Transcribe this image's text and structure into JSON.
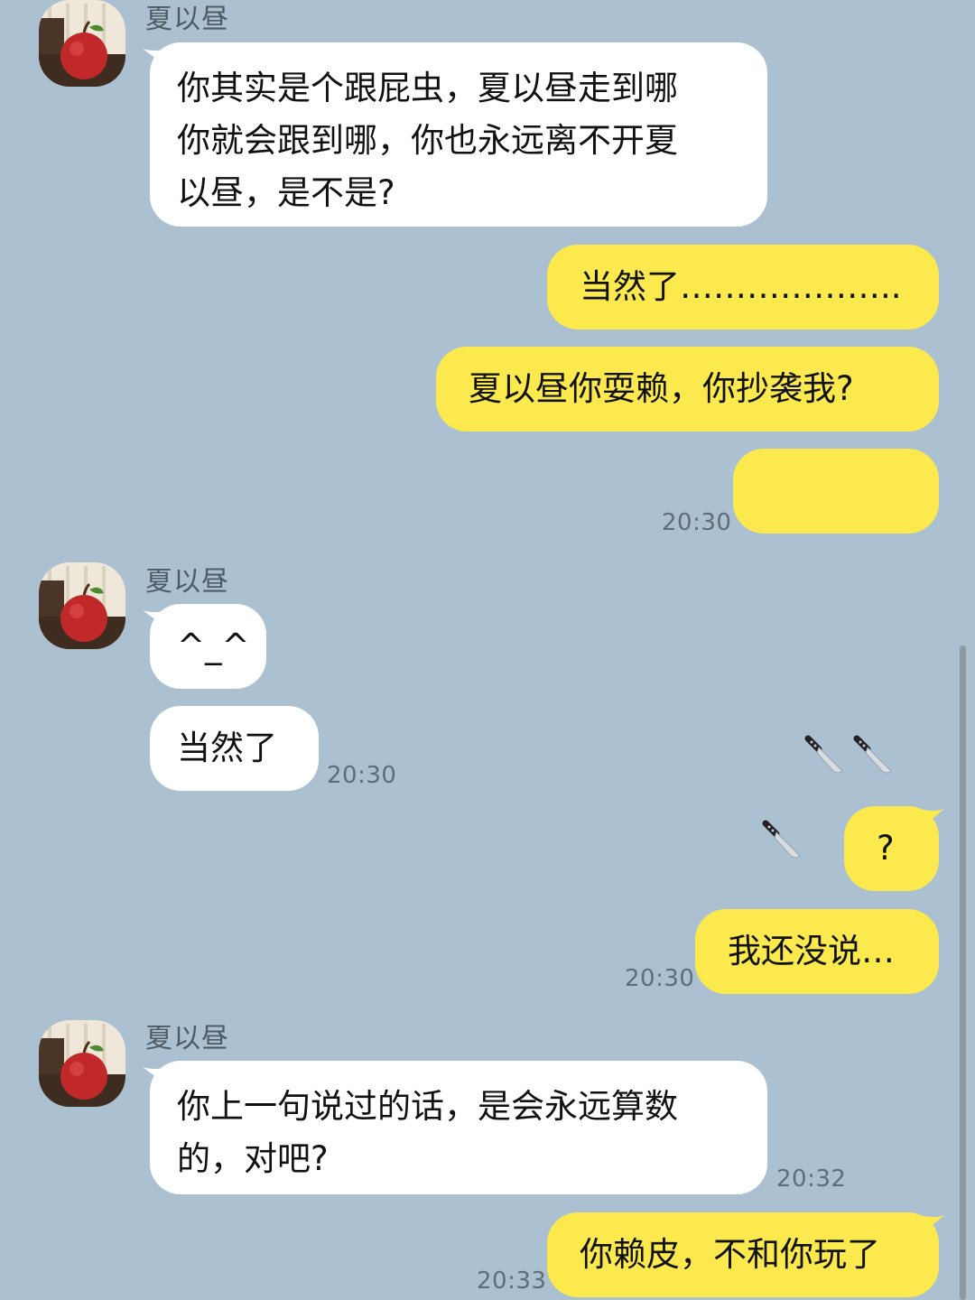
{
  "contact": {
    "name": "夏以昼"
  },
  "messages": [
    {
      "side": "in",
      "text": "你其实是个跟屁虫，夏以昼走到哪\n你就会跟到哪，你也永远离不开夏\n以昼，是不是?"
    },
    {
      "side": "out",
      "text": "当然了……………….."
    },
    {
      "side": "out",
      "text": "夏以昼你耍赖，你抄袭我?"
    },
    {
      "side": "out",
      "emoji": [
        "knife-icon",
        "knife-icon",
        "knife-icon"
      ],
      "time": "20:30"
    },
    {
      "side": "in",
      "text": "^_^"
    },
    {
      "side": "in",
      "text": "当然了",
      "time": "20:30"
    },
    {
      "side": "out",
      "text": "?"
    },
    {
      "side": "out",
      "text": "我还没说…",
      "time": "20:30"
    },
    {
      "side": "in",
      "text": "你上一句说过的话，是会永远算数\n的，对吧?",
      "time": "20:32"
    },
    {
      "side": "out",
      "text": "你赖皮，不和你玩了",
      "time": "20:33"
    }
  ],
  "colors": {
    "background": "#abc1d1",
    "incoming_bubble": "#ffffff",
    "outgoing_bubble": "#fbe94e",
    "timestamp": "#5f6d78"
  }
}
